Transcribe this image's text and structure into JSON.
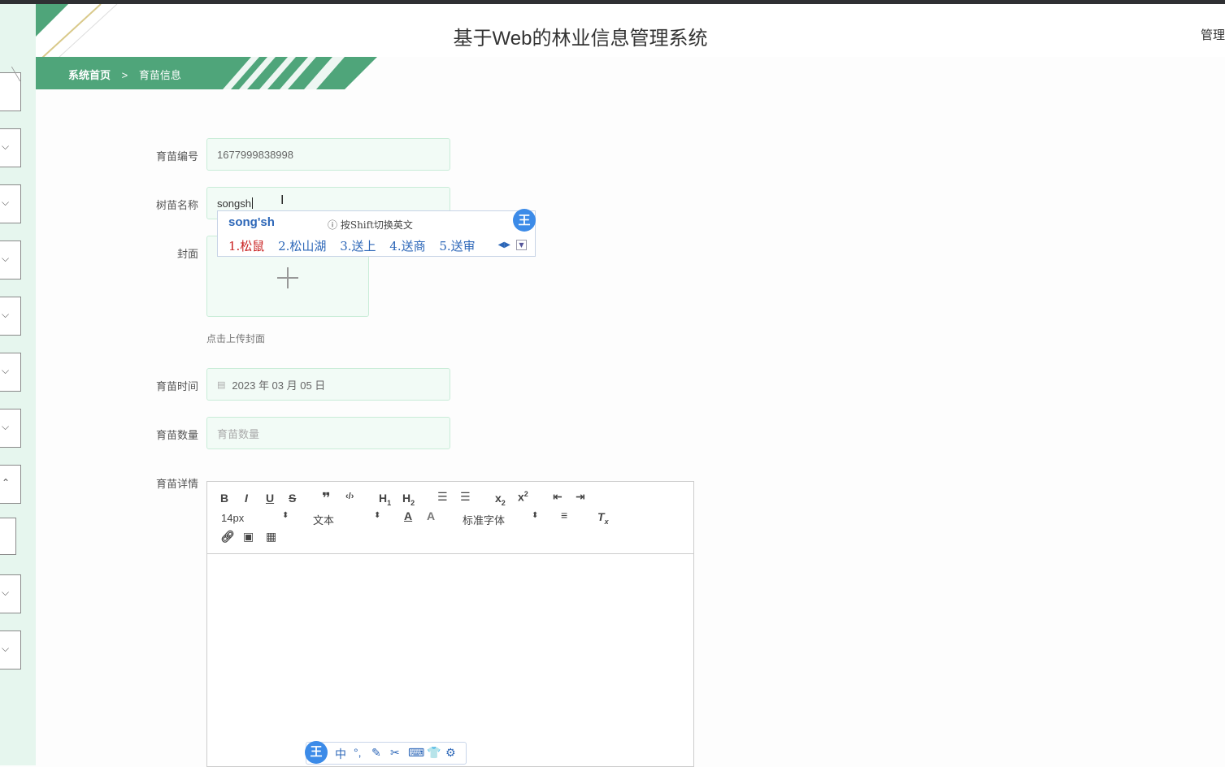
{
  "header": {
    "title": "基于Web的林业信息管理系统",
    "admin_label": "管理"
  },
  "breadcrumb": {
    "home": "系统首页",
    "separator": ">",
    "current": "育苗信息"
  },
  "form": {
    "seedling_id": {
      "label": "育苗编号",
      "value": "1677999838998"
    },
    "tree_name": {
      "label": "树苗名称",
      "value": "songsh"
    },
    "cover": {
      "label": "封面",
      "hint": "点击上传封面"
    },
    "date": {
      "label": "育苗时间",
      "value": "2023 年 03 月 05 日"
    },
    "quantity": {
      "label": "育苗数量",
      "placeholder": "育苗数量"
    },
    "details": {
      "label": "育苗详情"
    }
  },
  "editor": {
    "font_size": "14px",
    "header_select": "文本",
    "font_family": "标准字体"
  },
  "ime_popup": {
    "composition": "song'sh",
    "hint": "按Shift切换英文",
    "logo": "王",
    "candidates": [
      "1.松鼠",
      "2.松山湖",
      "3.送上",
      "4.送商",
      "5.送审"
    ]
  },
  "ime_bar": {
    "logo": "王",
    "items": [
      "中",
      "°,",
      "✎",
      "✂",
      "⌨",
      "👕",
      "⚙"
    ]
  },
  "colors": {
    "accent": "#4fa57a",
    "field_bg": "#f2fbf6",
    "ime_blue": "#2d67b8"
  }
}
